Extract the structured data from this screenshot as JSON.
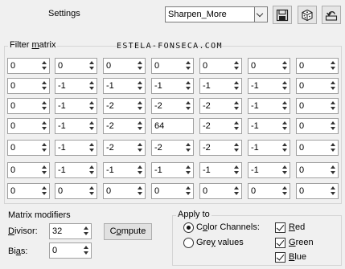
{
  "header": {
    "settings_label": "Settings",
    "preset_value": "Sharpen_More",
    "buttons": [
      {
        "name": "save-preset-button",
        "icon": "floppy-disk-icon"
      },
      {
        "name": "randomize-button",
        "icon": "dice-icon"
      },
      {
        "name": "reset-button",
        "icon": "undo-arrow-icon"
      }
    ]
  },
  "filter_matrix": {
    "title_pre": "Filter ",
    "title_ul": "m",
    "title_post": "atrix",
    "watermark": "ESTELA-FONSECA.COM",
    "rows": [
      [
        "0",
        "0",
        "0",
        "0",
        "0",
        "0",
        "0"
      ],
      [
        "0",
        "-1",
        "-1",
        "-1",
        "-1",
        "-1",
        "0"
      ],
      [
        "0",
        "-1",
        "-2",
        "-2",
        "-2",
        "-1",
        "0"
      ],
      [
        "0",
        "-1",
        "-2",
        "64",
        "-2",
        "-1",
        "0"
      ],
      [
        "0",
        "-1",
        "-2",
        "-2",
        "-2",
        "-1",
        "0"
      ],
      [
        "0",
        "-1",
        "-1",
        "-1",
        "-1",
        "-1",
        "0"
      ],
      [
        "0",
        "0",
        "0",
        "0",
        "0",
        "0",
        "0"
      ]
    ]
  },
  "modifiers": {
    "title": "Matrix modifiers",
    "divisor_pre": "",
    "divisor_ul": "D",
    "divisor_post": "ivisor:",
    "divisor_value": "32",
    "bias_pre": "Bi",
    "bias_ul": "a",
    "bias_post": "s:",
    "bias_value": "0",
    "compute_pre": "C",
    "compute_ul": "o",
    "compute_post": "mpute"
  },
  "apply_to": {
    "title": "Apply to",
    "color_pre": "C",
    "color_ul": "o",
    "color_post": "lor Channels:",
    "grey_pre": "Gre",
    "grey_ul": "y",
    "grey_post": " values",
    "red_pre": "",
    "red_ul": "R",
    "red_post": "ed",
    "green_pre": "",
    "green_ul": "G",
    "green_post": "reen",
    "blue_pre": "",
    "blue_ul": "B",
    "blue_post": "lue"
  }
}
